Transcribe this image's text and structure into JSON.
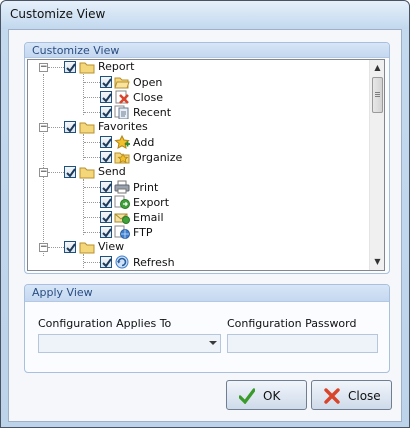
{
  "window": {
    "title": "Customize View"
  },
  "customize_group": {
    "title": "Customize View"
  },
  "tree": {
    "report": {
      "label": "Report",
      "children": [
        "Open",
        "Close",
        "Recent"
      ]
    },
    "favorites": {
      "label": "Favorites",
      "children": [
        "Add",
        "Organize"
      ]
    },
    "send": {
      "label": "Send",
      "children": [
        "Print",
        "Export",
        "Email",
        "FTP"
      ]
    },
    "view": {
      "label": "View",
      "children": [
        "Refresh"
      ]
    }
  },
  "apply_group": {
    "title": "Apply View",
    "applies_label": "Configuration Applies To",
    "password_label": "Configuration Password",
    "applies_value": "",
    "password_value": ""
  },
  "buttons": {
    "ok": "OK",
    "close": "Close"
  },
  "colors": {
    "accent": "#2a4d82",
    "check": "#1d5180",
    "folder": "#e8c25a",
    "ok_check": "#3a9a2a",
    "close_x": "#d9442a"
  }
}
